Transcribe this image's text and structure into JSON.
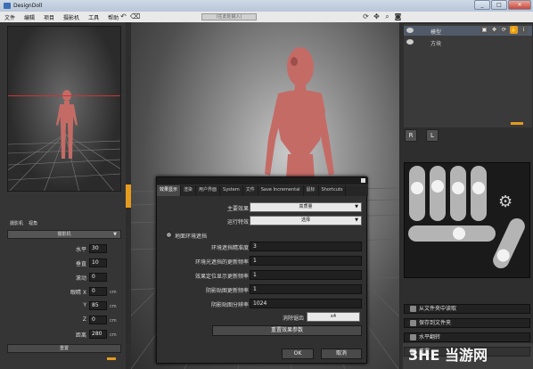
{
  "app": {
    "title": "DesignDoll"
  },
  "menu": {
    "items": [
      "文件",
      "编辑",
      "项目",
      "摄影机",
      "工具",
      "帮助"
    ],
    "search_placeholder": "(在此处输入)"
  },
  "left_panel": {
    "tabs": [
      "摄影机",
      "视角"
    ],
    "camera_select": "摄影机",
    "params": [
      {
        "label": "水平",
        "value": "30",
        "unit": ""
      },
      {
        "label": "垂直",
        "value": "10",
        "unit": ""
      },
      {
        "label": "滚动",
        "value": "0",
        "unit": ""
      },
      {
        "label": "眼睛 X",
        "value": "0",
        "unit": "cm"
      },
      {
        "label": "Y",
        "value": "85",
        "unit": "cm"
      },
      {
        "label": "Z",
        "value": "0",
        "unit": "cm"
      },
      {
        "label": "距离",
        "value": "280",
        "unit": "cm"
      }
    ],
    "reset_button": "重置"
  },
  "scene": {
    "items": [
      {
        "label": "模型",
        "selected": true
      },
      {
        "label": "方块",
        "selected": false
      }
    ],
    "toolbar_icons": [
      "select-icon",
      "move-icon",
      "rotate-icon",
      "zoom-icon",
      "hand-icon",
      "info-icon"
    ]
  },
  "hand_panel": {
    "buttons": [
      "R",
      "L"
    ]
  },
  "right_buttons": [
    {
      "label": "从文件夹中读取",
      "icon": "folder-open-icon"
    },
    {
      "label": "保存到文件夹",
      "icon": "folder-save-icon"
    },
    {
      "label": "水平翻转",
      "icon": "flip-icon"
    },
    {
      "label": "重置",
      "icon": "reset-icon"
    }
  ],
  "dialog": {
    "tabs": [
      "效果显示",
      "渲染",
      "用户界面",
      "System",
      "文件",
      "Save Incremental",
      "鼠标",
      "Shortcuts"
    ],
    "active_tab": 0,
    "main_effect_label": "主要效果",
    "main_effect_value": "高质量",
    "run_effect_label": "运行特效",
    "run_effect_value": "选择",
    "ground_occlusion_label": "地面环境遮挡",
    "fields": [
      {
        "label": "环境遮挡精准度",
        "value": "3"
      },
      {
        "label": "环境光遮挡的更新频率",
        "value": "1"
      },
      {
        "label": "效果定位显示更新频率",
        "value": "1"
      },
      {
        "label": "阴影贴图更新频率",
        "value": "1"
      },
      {
        "label": "阴影贴图分辨率",
        "value": "1024"
      }
    ],
    "aa_label": "消除锯齿",
    "aa_value": "x4",
    "reset_effects_button": "重置效果参数",
    "ok_button": "OK",
    "cancel_button": "取消"
  },
  "watermark": {
    "text": "当游网",
    "domain": "3HE"
  },
  "colors": {
    "accent": "#e49b1f",
    "figure": "#c46b66"
  }
}
